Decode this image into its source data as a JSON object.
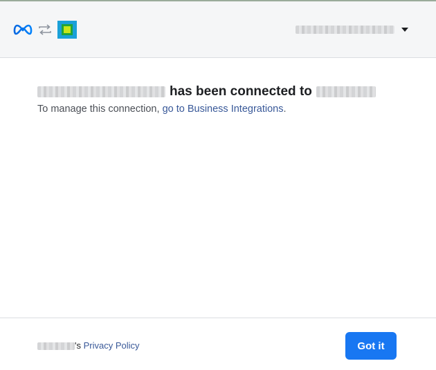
{
  "header": {
    "logo": "meta-logo",
    "swap": "swap-arrows-icon",
    "app_icon": "app-icon",
    "account_menu_icon": "caret-down-icon"
  },
  "content": {
    "headline_connected": "has been connected to",
    "manage_prefix": "To manage this connection, ",
    "manage_link": "go to Business Integrations",
    "manage_suffix": "."
  },
  "footer": {
    "privacy_suffix": "'s",
    "privacy_link": "Privacy Policy",
    "got_it": "Got it"
  },
  "colors": {
    "primary": "#1877f2",
    "link": "#385898",
    "header_bg": "#f5f6f7"
  }
}
